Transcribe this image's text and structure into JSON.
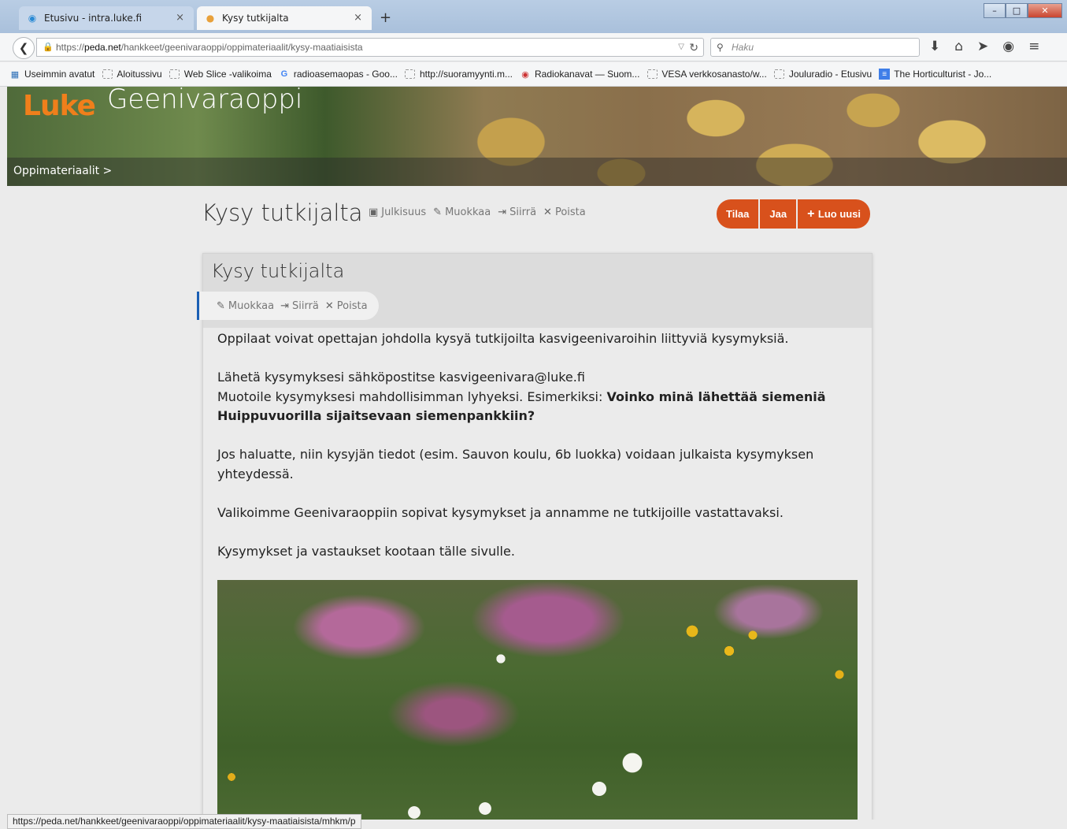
{
  "browser": {
    "tabs": [
      {
        "label": "Etusivu - intra.luke.fi",
        "icon": "chat-bubble-icon",
        "active": false
      },
      {
        "label": "Kysy tutkijalta",
        "icon": "peda-favicon",
        "active": true
      }
    ],
    "new_tab_glyph": "+",
    "tab_close_glyph": "×",
    "url": {
      "prefix": "https://",
      "host": "peda.net",
      "path": "/hankkeet/geenivaraoppi/oppimateriaalit/kysy-maatiaisista"
    },
    "search_placeholder": "Haku",
    "bookmarks": [
      {
        "label": "Useimmin avatut",
        "icon": "most-visited-icon"
      },
      {
        "label": "Aloitussivu",
        "icon": "folder-icon"
      },
      {
        "label": "Web Slice -valikoima",
        "icon": "folder-icon"
      },
      {
        "label": "radioasemaopas - Goo...",
        "icon": "google-icon"
      },
      {
        "label": "http://suoramyynti.m...",
        "icon": "folder-icon"
      },
      {
        "label": "Radiokanavat — Suom...",
        "icon": "radio-icon"
      },
      {
        "label": "VESA verkkosanasto/w...",
        "icon": "folder-icon"
      },
      {
        "label": "Jouluradio - Etusivu",
        "icon": "folder-icon"
      },
      {
        "label": "The Horticulturist - Jo...",
        "icon": "google-docs-icon"
      }
    ],
    "status_url": "https://peda.net/hankkeet/geenivaraoppi/oppimateriaalit/kysy-maatiaisista/mhkm/p"
  },
  "site": {
    "logo": "Luke",
    "title": "Geenivaraoppi",
    "breadcrumb": "Oppimateriaalit >"
  },
  "page": {
    "title": "Kysy tutkijalta",
    "tools": {
      "julkisuus": "Julkisuus",
      "muokkaa": "Muokkaa",
      "siirra": "Siirrä",
      "poista": "Poista"
    },
    "actions": {
      "tilaa": "Tilaa",
      "jaa": "Jaa",
      "luo_uusi": "Luo uusi"
    }
  },
  "card": {
    "title": "Kysy tutkijalta",
    "tools": {
      "muokkaa": "Muokkaa",
      "siirra": "Siirrä",
      "poista": "Poista"
    },
    "p1": "Oppilaat voivat opettajan johdolla kysyä tutkijoilta kasvigeenivaroihin liittyviä kysymyksiä.",
    "p2_line1": "Lähetä kysymyksesi sähköpostitse kasvigeenivara@luke.fi",
    "p2_line2_plain": "Muotoile kysymyksesi mahdollisimman lyhyeksi. Esimerkiksi: ",
    "p2_line2_bold": "Voinko minä lähettää siemeniä Huippuvuorilla sijaitsevaan siemenpankkiin?",
    "p3": "Jos haluatte, niin kysyjän tiedot (esim. Sauvon koulu, 6b luokka) voidaan julkaista kysymyksen yhteydessä.",
    "p4": "Valikoimme Geenivaraoppiin sopivat kysymykset ja annamme ne tutkijoille vastattavaksi.",
    "p5": "Kysymykset ja vastaukset kootaan tälle sivulle."
  },
  "colors": {
    "accent": "#d8511c",
    "tool_edge": "#1a5fb4",
    "logo": "#f07f1b"
  }
}
